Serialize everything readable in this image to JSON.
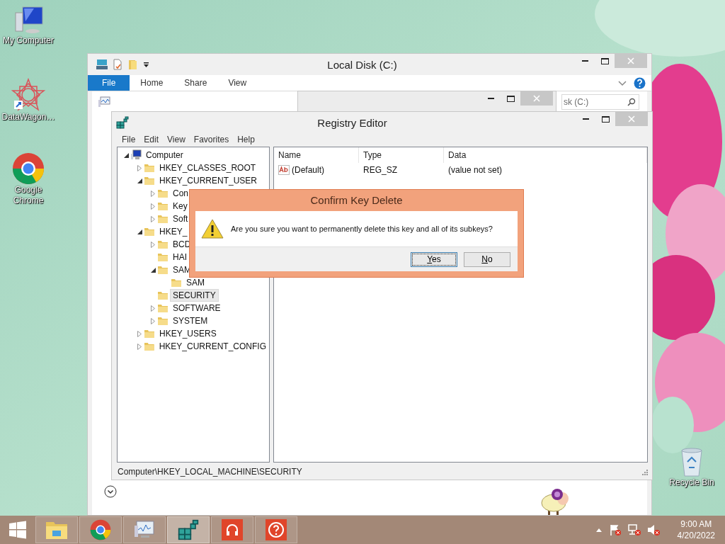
{
  "desktop_icons": [
    {
      "label": "My Computer",
      "kind": "computer"
    },
    {
      "label": "DataWagon…",
      "kind": "star"
    },
    {
      "label": "Google Chrome",
      "kind": "chrome"
    },
    {
      "label": "Recycle Bin",
      "kind": "recycle"
    }
  ],
  "explorer": {
    "title": "Local Disk (C:)",
    "tabs": [
      {
        "label": "File",
        "selected": true
      },
      {
        "label": "Home",
        "selected": false
      },
      {
        "label": "Share",
        "selected": false
      },
      {
        "label": "View",
        "selected": false
      }
    ],
    "search": {
      "placeholder": "sk (C:)"
    }
  },
  "registry": {
    "title": "Registry Editor",
    "menu": [
      "File",
      "Edit",
      "View",
      "Favorites",
      "Help"
    ],
    "tree": {
      "label": "Computer",
      "expanded": true,
      "selected": false,
      "children": [
        {
          "label": "HKEY_CLASSES_ROOT",
          "expanded": false,
          "selected": false
        },
        {
          "label": "HKEY_CURRENT_USER",
          "expanded": true,
          "selected": false,
          "children": [
            {
              "label": "Con",
              "expanded": false,
              "selected": false
            },
            {
              "label": "Key",
              "expanded": false,
              "selected": false
            },
            {
              "label": "Soft",
              "expanded": false,
              "selected": false
            }
          ]
        },
        {
          "label": "HKEY_",
          "expanded": true,
          "selected": false,
          "children": [
            {
              "label": "BCD",
              "expanded": false,
              "selected": false
            },
            {
              "label": "HAI",
              "selected": false
            },
            {
              "label": "SAM",
              "expanded": true,
              "selected": false,
              "children": [
                {
                  "label": "SAM",
                  "selected": false
                }
              ]
            },
            {
              "label": "SECURITY",
              "selected": true
            },
            {
              "label": "SOFTWARE",
              "expanded": false,
              "selected": false
            },
            {
              "label": "SYSTEM",
              "expanded": false,
              "selected": false
            }
          ]
        },
        {
          "label": "HKEY_USERS",
          "expanded": false,
          "selected": false
        },
        {
          "label": "HKEY_CURRENT_CONFIG",
          "expanded": false,
          "selected": false
        }
      ]
    },
    "columns": [
      "Name",
      "Type",
      "Data"
    ],
    "rows": [
      {
        "name": "(Default)",
        "type": "REG_SZ",
        "data": "(value not set)"
      }
    ],
    "status": "Computer\\HKEY_LOCAL_MACHINE\\SECURITY"
  },
  "dialog": {
    "title": "Confirm Key Delete",
    "message": "Are you sure you want to permanently delete this key and all of its subkeys?",
    "buttons": [
      {
        "label": "Yes",
        "focused": true
      },
      {
        "label": "No",
        "focused": false
      }
    ]
  },
  "taskbar": {
    "apps": [
      {
        "kind": "explorer",
        "active": false
      },
      {
        "kind": "chrome",
        "active": false
      },
      {
        "kind": "monitor",
        "active": false
      },
      {
        "kind": "registry",
        "active": true
      },
      {
        "kind": "headphones",
        "active": false
      },
      {
        "kind": "help",
        "active": false
      }
    ],
    "time": "9:00 AM",
    "date": "4/20/2022"
  }
}
